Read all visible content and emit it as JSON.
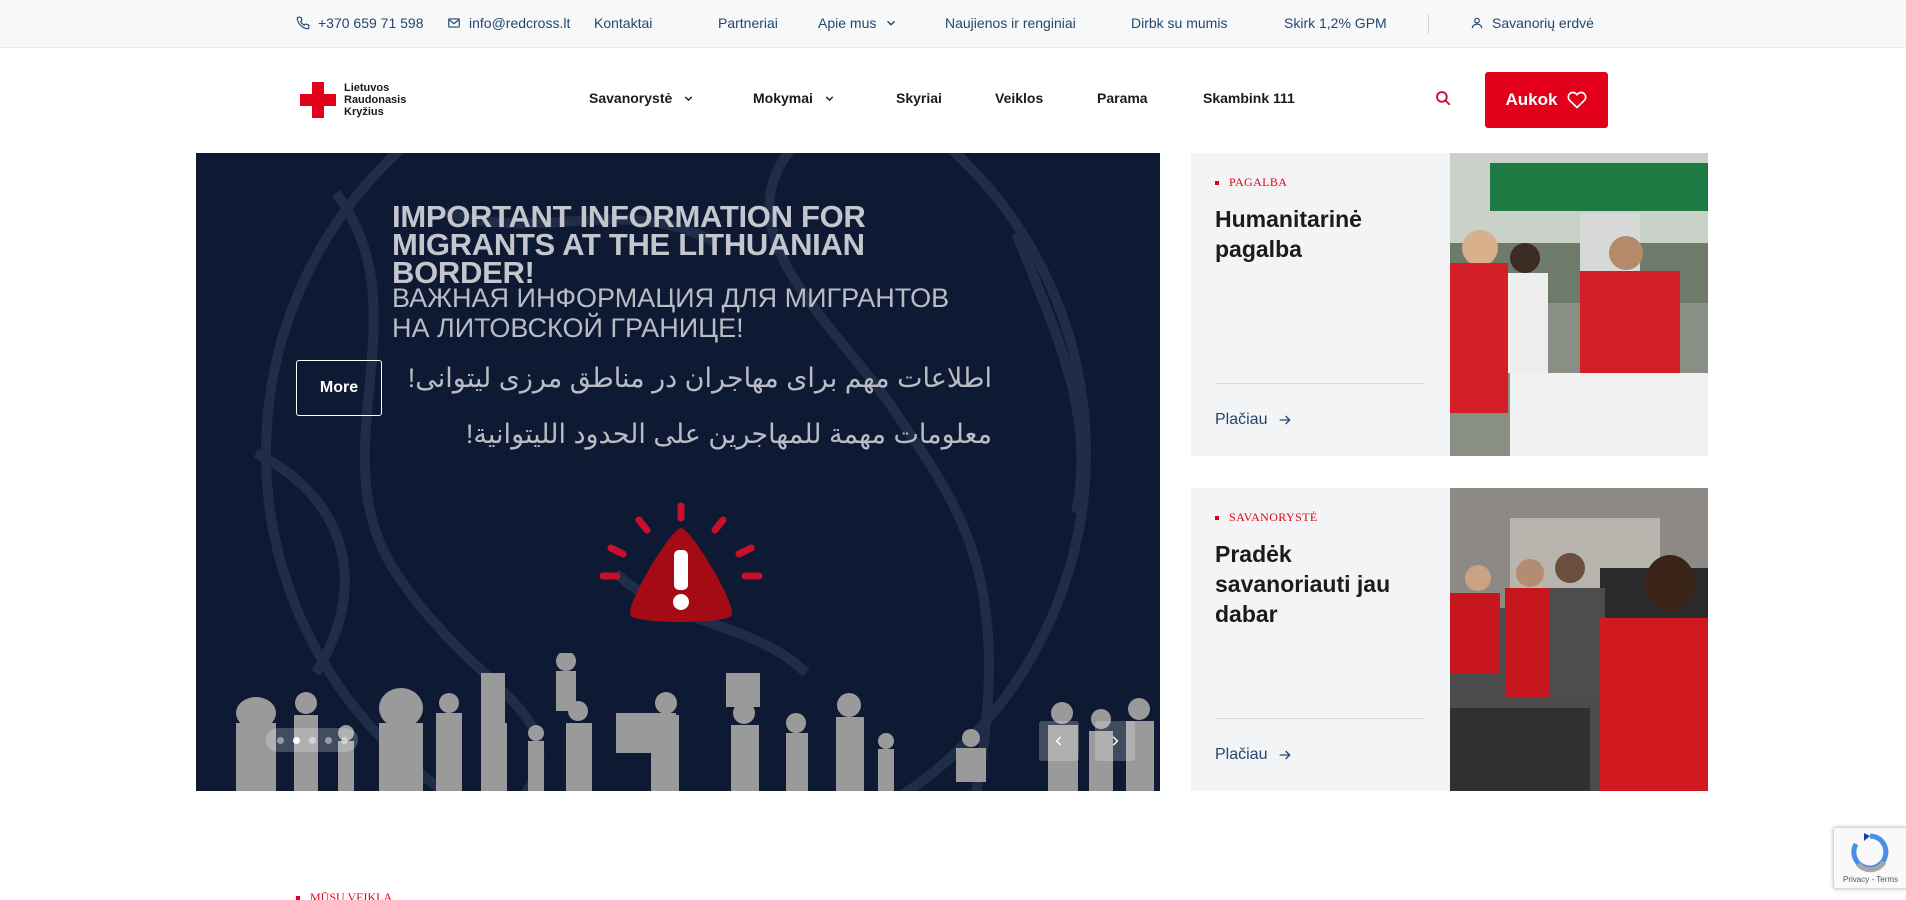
{
  "topbar": {
    "phone": "+370 659 71 598",
    "email": "info@redcross.lt",
    "links": [
      "Kontaktai",
      "Partneriai",
      "Apie mus",
      "Naujienos ir renginiai",
      "Dirbk su mumis",
      "Skirk 1,2% GPM"
    ],
    "volunteer_area": "Savanorių erdvė",
    "icons": {
      "phone": "phone-icon",
      "email": "mail-icon",
      "user": "user-icon",
      "chevron": "chevron-down-icon"
    }
  },
  "header": {
    "logo": {
      "line1": "Lietuvos",
      "line2": "Raudonasis",
      "line3": "Kryžius"
    },
    "nav": [
      "Savanorystė",
      "Mokymai",
      "Skyriai",
      "Veiklos",
      "Parama",
      "Skambink 111"
    ],
    "donate_label": "Aukok",
    "colors": {
      "brand_red": "#e3001b",
      "link_blue": "#24476b",
      "hero_navy": "#0e1a33"
    }
  },
  "hero": {
    "more_label": "More",
    "slide": {
      "title_line1": "IMPORTANT INFORMATION FOR",
      "title_line2": "MIGRANTS AT THE LITHUANIAN BORDER!",
      "ru_line1": "ВАЖНАЯ ИНФОРМАЦИЯ ДЛЯ МИГРАНТОВ",
      "ru_line2": "НА ЛИТОВСКОЙ ГРАНИЦЕ!",
      "fa": "اطلاعات مهم برای مهاجران در مناطق مرزی لیتوانی!",
      "ar": "معلومات مهمة للمهاجرين على الحدود الليتوانية!"
    },
    "slides_count": 5,
    "active_slide": 2
  },
  "cards": [
    {
      "category": "PAGALBA",
      "title": "Humanitarinė pagalba",
      "link": "Plačiau"
    },
    {
      "category": "SAVANORYSTĖ",
      "title": "Pradėk savanoriauti jau dabar",
      "link": "Plačiau"
    }
  ],
  "bottom": {
    "section_label": "MŪSŲ VEIKLA",
    "recaptcha_text": "Privacy - Terms"
  }
}
